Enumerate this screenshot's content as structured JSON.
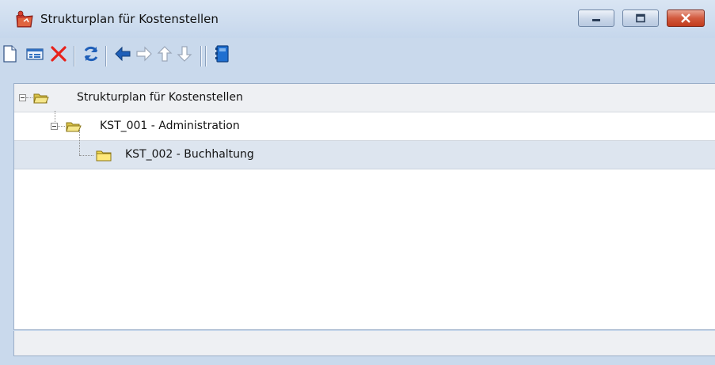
{
  "window": {
    "title": "Strukturplan für Kostenstellen"
  },
  "title_controls": {
    "minimize_icon": "minimize-icon",
    "maximize_icon": "maximize-icon",
    "close_icon": "close-icon"
  },
  "toolbar": {
    "buttons": [
      {
        "name": "new-document-icon"
      },
      {
        "name": "properties-icon"
      },
      {
        "name": "delete-icon"
      },
      {
        "name": "refresh-icon"
      },
      {
        "name": "arrow-left-icon"
      },
      {
        "name": "arrow-right-icon"
      },
      {
        "name": "arrow-up-icon"
      },
      {
        "name": "arrow-down-icon"
      },
      {
        "name": "book-icon"
      }
    ]
  },
  "tree": {
    "nodes": [
      {
        "label": "Strukturplan für Kostenstellen",
        "level": 0,
        "expanded": true,
        "selected": false
      },
      {
        "label": "KST_001 - Administration",
        "level": 1,
        "expanded": true,
        "selected": false
      },
      {
        "label": "KST_002 - Buchhaltung",
        "level": 2,
        "expanded": false,
        "selected": true
      }
    ]
  },
  "status_bar": {
    "text": ""
  },
  "colors": {
    "titlebar": "#c6d7ec",
    "selection": "#dde5ef",
    "delete_red": "#e8221b",
    "arrow_blue": "#1f5fb8",
    "close_red": "#c13b1d"
  }
}
